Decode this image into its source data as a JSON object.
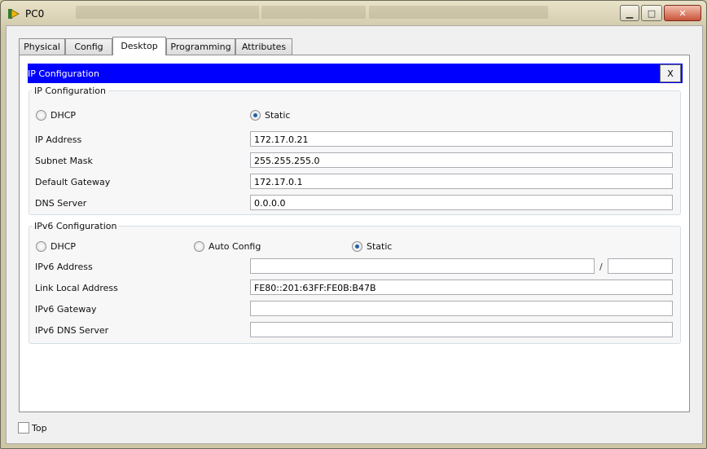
{
  "window": {
    "title": "PC0"
  },
  "tabs": [
    "Physical",
    "Config",
    "Desktop",
    "Programming",
    "Attributes"
  ],
  "app": {
    "title": "IP Configuration",
    "close_label": "X"
  },
  "ipv4": {
    "legend": "IP Configuration",
    "dhcp_label": "DHCP",
    "static_label": "Static",
    "mode": "Static",
    "ip_label": "IP Address",
    "ip_value": "172.17.0.21",
    "mask_label": "Subnet Mask",
    "mask_value": "255.255.255.0",
    "gateway_label": "Default Gateway",
    "gateway_value": "172.17.0.1",
    "dns_label": "DNS Server",
    "dns_value": "0.0.0.0"
  },
  "ipv6": {
    "legend": "IPv6 Configuration",
    "dhcp_label": "DHCP",
    "auto_label": "Auto Config",
    "static_label": "Static",
    "mode": "Static",
    "address_label": "IPv6 Address",
    "address_value": "",
    "prefix_value": "",
    "slash": "/",
    "link_local_label": "Link Local Address",
    "link_local_value": "FE80::201:63FF:FE0B:B47B",
    "gateway_label": "IPv6 Gateway",
    "gateway_value": "",
    "dns_label": "IPv6 DNS Server",
    "dns_value": ""
  },
  "footer": {
    "top_label": "Top",
    "top_checked": false
  }
}
